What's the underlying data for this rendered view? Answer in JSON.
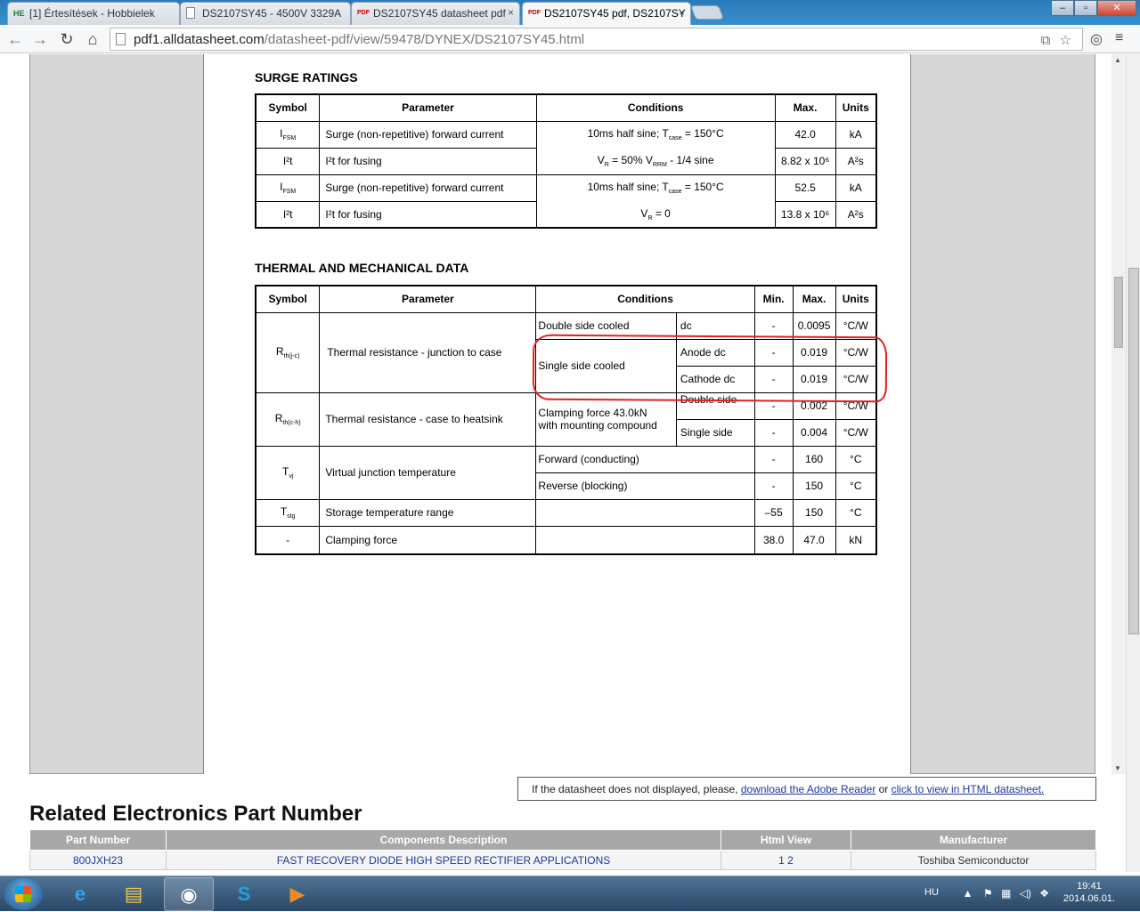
{
  "browser": {
    "tabs": [
      {
        "icon": "HE",
        "title": "[1] Értesítések - Hobbielek"
      },
      {
        "icon": "",
        "title": "DS2107SY45 - 4500V 3329A"
      },
      {
        "icon": "PDF",
        "title": "DS2107SY45 datasheet pdf"
      },
      {
        "icon": "PDF",
        "title": "DS2107SY45 pdf, DS2107SY"
      }
    ],
    "url_host": "pdf1.alldatasheet.com",
    "url_path": "/datasheet-pdf/view/59478/DYNEX/DS2107SY45.html"
  },
  "surge": {
    "title": "SURGE RATINGS",
    "headers": [
      "Symbol",
      "Parameter",
      "Conditions",
      "Max.",
      "Units"
    ],
    "rows": [
      {
        "sym": "I",
        "sub": "FSM",
        "param": "Surge (non-repetitive) forward current",
        "max": "42.0",
        "unit": "kA"
      },
      {
        "sym": "I²t",
        "sub": "",
        "param": "I²t for fusing",
        "max": "8.82 x 10⁶",
        "unit": "A²s"
      },
      {
        "sym": "I",
        "sub": "FSM",
        "param": "Surge (non-repetitive) forward current",
        "max": "52.5",
        "unit": "kA"
      },
      {
        "sym": "I²t",
        "sub": "",
        "param": "I²t for fusing",
        "max": "13.8 x 10⁶",
        "unit": "A²s"
      }
    ],
    "cond1a": "10ms half sine;  T",
    "cond1a_sub": "case",
    "cond1a_tail": " = 150°C",
    "cond1b": "V",
    "cond1b_sub": "R",
    "cond1b_mid": " = 50% V",
    "cond1b_sub2": "RRM",
    "cond1b_tail": " - 1/4 sine",
    "cond2a": "10ms half sine;  T",
    "cond2a_sub": "case",
    "cond2a_tail": " = 150°C",
    "cond2b": "V",
    "cond2b_sub": "R",
    "cond2b_tail": " = 0"
  },
  "thermal": {
    "title": "THERMAL AND MECHANICAL DATA",
    "headers": [
      "Symbol",
      "Parameter",
      "Conditions",
      "Min.",
      "Max.",
      "Units"
    ],
    "rth_jc": {
      "sym": "R",
      "sub": "th(j-c)",
      "param": "Thermal resistance - junction to case"
    },
    "rth_ch": {
      "sym": "R",
      "sub": "th(c-h)",
      "param": "Thermal resistance - case to heatsink"
    },
    "tvj": {
      "sym": "T",
      "sub": "vj",
      "param": "Virtual junction temperature"
    },
    "tstg": {
      "sym": "T",
      "sub": "stg",
      "param": "Storage temperature range",
      "min": "–55",
      "max": "150",
      "unit": "°C"
    },
    "clamp": {
      "sym": "-",
      "param": "Clamping force",
      "min": "38.0",
      "max": "47.0",
      "unit": "kN"
    },
    "r1": {
      "c1": "Double side cooled",
      "c2": "dc",
      "min": "-",
      "max": "0.0095",
      "unit": "°C/W"
    },
    "r2": {
      "c1": "Single side cooled",
      "c2": "Anode dc",
      "min": "-",
      "max": "0.019",
      "unit": "°C/W"
    },
    "r3": {
      "c2": "Cathode dc",
      "min": "-",
      "max": "0.019",
      "unit": "°C/W"
    },
    "r4": {
      "c1a": "Clamping force 43.0kN",
      "c1b": "with mounting compound",
      "c2": "Double side",
      "min": "-",
      "max": "0.002",
      "unit": "°C/W"
    },
    "r5": {
      "c2": "Single side",
      "min": "-",
      "max": "0.004",
      "unit": "°C/W"
    },
    "r6": {
      "c1": "Forward (conducting)",
      "min": "-",
      "max": "160",
      "unit": "°C"
    },
    "r7": {
      "c1": "Reverse (blocking)",
      "min": "-",
      "max": "150",
      "unit": "°C"
    }
  },
  "note": {
    "prefix": "If the datasheet does not displayed, please, ",
    "link1": "download the Adobe Reader",
    "mid": " or ",
    "link2": "click to view in HTML datasheet."
  },
  "related": {
    "title": "Related Electronics Part Number",
    "headers": [
      "Part Number",
      "Components Description",
      "Html View",
      "Manufacturer"
    ],
    "rows": [
      {
        "part": "800JXH23",
        "desc": "FAST RECOVERY DIODE HIGH SPEED RECTIFIER APPLICATIONS",
        "html": "1 2",
        "mfr": "Toshiba Semiconductor"
      }
    ]
  },
  "taskbar": {
    "lang": "HU",
    "time": "19:41",
    "date": "2014.06.01."
  }
}
